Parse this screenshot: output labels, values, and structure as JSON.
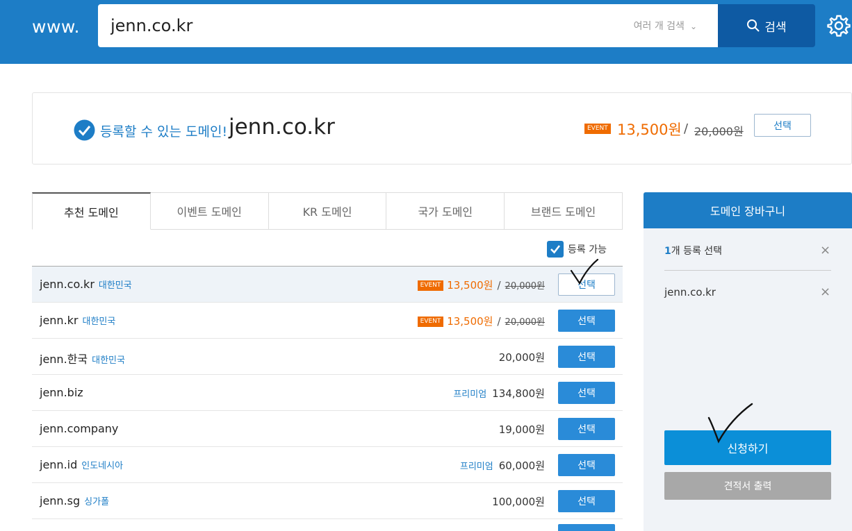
{
  "header": {
    "www": "www.",
    "search_value": "jenn.co.kr",
    "multi_search": "여러 개 검색",
    "search_button": "검색"
  },
  "result": {
    "available": "등록할 수 있는 도메인!",
    "domain": "jenn.co.kr",
    "event": "EVENT",
    "price": "13,500원",
    "slash": "/",
    "original_price": "20,000원",
    "select": "선택"
  },
  "tabs": [
    "추천 도메인",
    "이벤트 도메인",
    "KR 도메인",
    "국가 도메인",
    "브랜드 도메인"
  ],
  "filter": {
    "label": "등록 가능"
  },
  "rows": [
    {
      "domain": "jenn.co.kr",
      "country": "대한민국",
      "event": "EVENT",
      "price": "13,500원",
      "original": "20,000원",
      "button": "선택"
    },
    {
      "domain": "jenn.kr",
      "country": "대한민국",
      "event": "EVENT",
      "price": "13,500원",
      "original": "20,000원",
      "button": "선택"
    },
    {
      "domain": "jenn.한국",
      "country": "대한민국",
      "price": "20,000원",
      "button": "선택"
    },
    {
      "domain": "jenn.biz",
      "country": "",
      "premium": "프리미엄",
      "price": "134,800원",
      "button": "선택"
    },
    {
      "domain": "jenn.company",
      "country": "",
      "price": "19,000원",
      "button": "선택"
    },
    {
      "domain": "jenn.id",
      "country": "인도네시아",
      "premium": "프리미엄",
      "price": "60,000원",
      "button": "선택"
    },
    {
      "domain": "jenn.sg",
      "country": "싱가폴",
      "price": "100,000원",
      "button": "선택"
    }
  ],
  "cart": {
    "title": "도메인 장바구니",
    "count_num": "1",
    "count_text": "개 등록 선택",
    "item": "jenn.co.kr",
    "close": "×",
    "apply": "신청하기",
    "quote": "견적서 출력"
  },
  "colors": {
    "brand": "#1d7dc6",
    "event": "#ef6b00",
    "button": "#2a8bd8"
  }
}
